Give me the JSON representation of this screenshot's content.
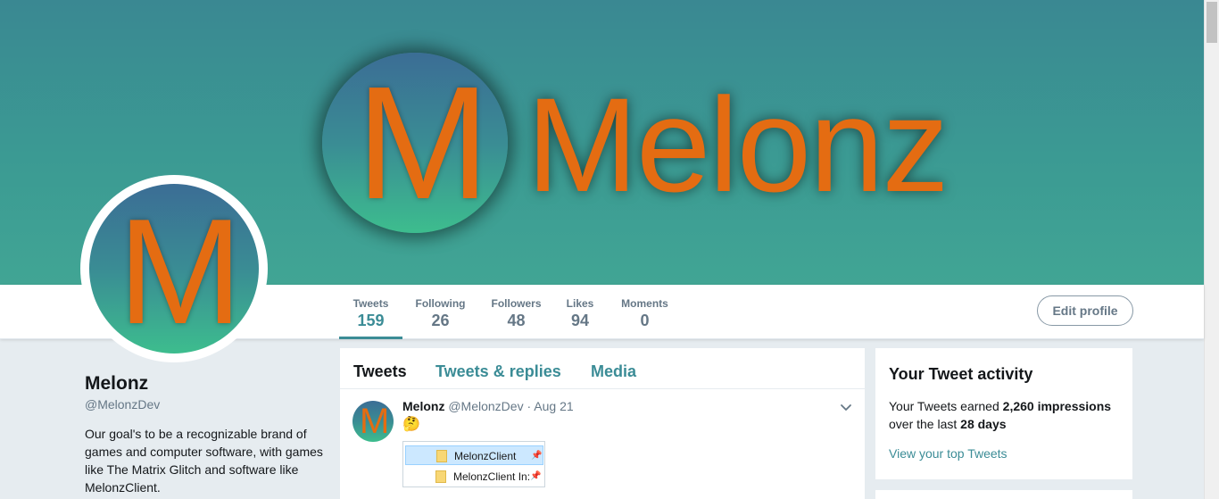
{
  "banner": {
    "logo_letter": "M",
    "wordmark": "Melonz"
  },
  "profile": {
    "avatar_letter": "M",
    "name": "Melonz",
    "handle": "@MelonzDev",
    "bio": "Our goal's to be a recognizable brand of games and computer software, with games like The Matrix Glitch and software like MelonzClient."
  },
  "stats": [
    {
      "label": "Tweets",
      "value": "159",
      "active": true
    },
    {
      "label": "Following",
      "value": "26"
    },
    {
      "label": "Followers",
      "value": "48"
    },
    {
      "label": "Likes",
      "value": "94"
    },
    {
      "label": "Moments",
      "value": "0"
    }
  ],
  "edit_profile_label": "Edit profile",
  "timeline": {
    "tabs": [
      {
        "label": "Tweets",
        "active": true
      },
      {
        "label": "Tweets & replies"
      },
      {
        "label": "Media"
      }
    ],
    "tweet": {
      "avatar_letter": "M",
      "name": "Melonz",
      "handle": "@MelonzDev",
      "separator": "·",
      "time": "Aug 21",
      "emoji": "🤔",
      "media": {
        "rows": [
          {
            "label": "MelonzClient",
            "selected": true
          },
          {
            "label": "MelonzClient In:"
          }
        ]
      }
    }
  },
  "activity": {
    "title": "Your Tweet activity",
    "earned_prefix": "Your Tweets earned ",
    "impressions": "2,260 impressions",
    "period_prefix": "over the last ",
    "period": "28 days",
    "link": "View your top Tweets"
  },
  "colors": {
    "accent": "#3b8c96",
    "brand_orange": "#e46c12",
    "banner_teal": "#3b9a93"
  }
}
